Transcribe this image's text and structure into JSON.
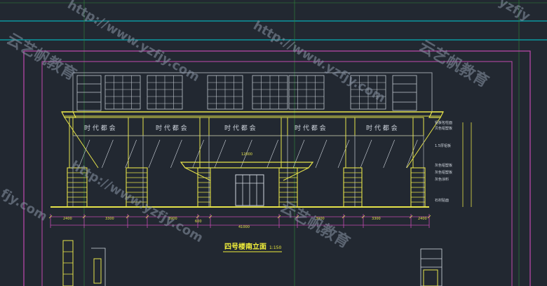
{
  "colors": {
    "background": "#222831",
    "frame_outer": "#4a5a9a",
    "frame_inner": "#c24ab0",
    "cyan_line": "#00cfd8",
    "green_grid": "#2f8a3a",
    "building_yellow": "#e6e34a",
    "building_gray": "#9aa0a8",
    "glass_white": "#d0d6de",
    "title_yellow": "#f0ee3a",
    "watermark": "#8a96a6"
  },
  "drawing": {
    "title": "四号楼南立面",
    "scale": "1:150",
    "store_signs": [
      "时 代 都 会",
      "时 代 都 会",
      "时 代 都 会",
      "时 代 都 会",
      "时 代 都 会"
    ],
    "annotations": [
      "铝板包柱面",
      "贝色铝塑板",
      "1.5厚铝板",
      "灰色铝塑板",
      "灰色铝塑板",
      "灰色涂料",
      "石材贴面"
    ],
    "dims_bottom": [
      "2400",
      "3300",
      "3900",
      "3900",
      "3300",
      "2400"
    ],
    "dims_overall": "41000",
    "dims_mid": "600",
    "center_label": "12000"
  },
  "watermarks": {
    "brand": "云艺帆教育",
    "url": "http://www.yzfjy.com",
    "short": "yzfjy",
    "cut": "fjy.com"
  },
  "icons": {
    "cad_canvas": "cad-drawing-canvas"
  }
}
